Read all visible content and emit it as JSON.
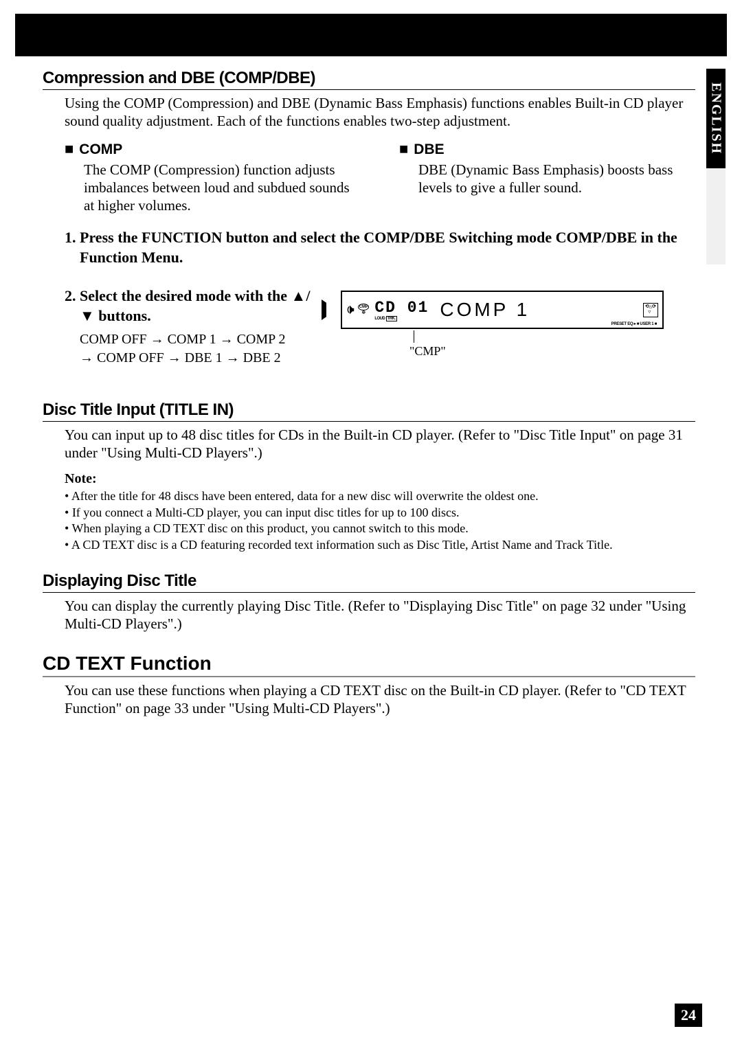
{
  "lang_tab": "ENGLISH",
  "page_number": "24",
  "section1": {
    "heading": "Compression and DBE (COMP/DBE)",
    "intro": "Using the COMP (Compression) and DBE (Dynamic Bass Emphasis) functions enables Built-in CD player sound quality adjustment. Each of the functions enables two-step adjustment.",
    "comp": {
      "title": "COMP",
      "body": "The COMP (Compression) function adjusts imbalances between loud and subdued sounds at higher volumes."
    },
    "dbe": {
      "title": "DBE",
      "body": "DBE (Dynamic Bass Emphasis) boosts bass levels to give a fuller sound."
    },
    "step1": "1.  Press the FUNCTION button and select the COMP/DBE Switching mode COMP/DBE in the Function Menu.",
    "step2": "2.  Select the desired mode with the ▲/▼ buttons.",
    "sequence_l1": "COMP OFF → COMP 1 → COMP 2",
    "sequence_l2": "→ COMP OFF → DBE 1 → DBE 2",
    "display": {
      "cd": "CD 01",
      "main": "COMP 1",
      "cmp_badge": "CMP",
      "loud": "LOUD",
      "trk": "TRK.",
      "preset": "PRESET EQ ▸ ■ USER 1 ■",
      "pointer_label": "\"CMP\""
    }
  },
  "section2": {
    "heading": "Disc Title Input (TITLE IN)",
    "body": "You can input up to 48 disc titles for CDs in the Built-in CD player. (Refer to \"Disc Title Input\" on page 31 under \"Using Multi-CD Players\".)",
    "note_label": "Note:",
    "notes": [
      "After the title for 48 discs have been entered, data for a new disc will overwrite the oldest one.",
      "If you connect a Multi-CD player, you can input disc titles for up to 100 discs.",
      "When playing a CD TEXT disc on this product, you cannot switch to this mode.",
      "A CD TEXT disc is a CD featuring recorded text information such as Disc Title, Artist Name and Track Title."
    ]
  },
  "section3": {
    "heading": "Displaying Disc Title",
    "body": "You can display the currently playing Disc Title. (Refer to \"Displaying Disc Title\" on page 32 under \"Using Multi-CD Players\".)"
  },
  "section4": {
    "heading": "CD TEXT Function",
    "body": "You can use these functions when playing a CD TEXT disc on the Built-in CD player. (Refer to \"CD TEXT Function\" on page 33 under \"Using Multi-CD Players\".)"
  }
}
